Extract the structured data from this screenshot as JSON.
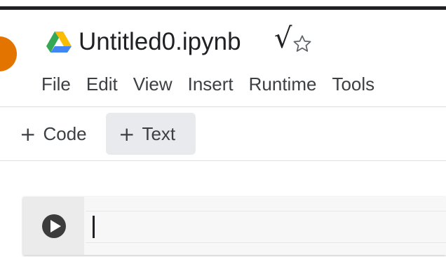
{
  "header": {
    "title": "Untitled0.ipynb",
    "check_mark": "√"
  },
  "menu": [
    {
      "label": "File"
    },
    {
      "label": "Edit"
    },
    {
      "label": "View"
    },
    {
      "label": "Insert"
    },
    {
      "label": "Runtime"
    },
    {
      "label": "Tools"
    }
  ],
  "toolbar": {
    "add_code_label": "Code",
    "add_text_label": "Text",
    "plus": "+"
  },
  "icons": {
    "app": "google-drive-icon",
    "favorite": "star-outline-icon",
    "run": "play-circle-icon"
  },
  "colors": {
    "avatar": "#e37400",
    "drive_green": "#34a853",
    "drive_yellow": "#fbbc04",
    "drive_blue": "#4285f4",
    "text_button_bg": "#e8eaed"
  }
}
